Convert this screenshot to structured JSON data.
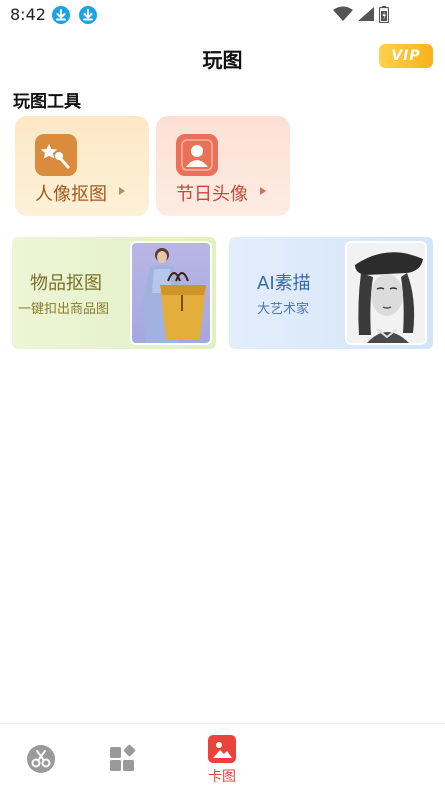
{
  "status_bar": {
    "time": "8:42",
    "icons": [
      "download-icon",
      "download-icon",
      "wifi-icon",
      "cell-signal-icon",
      "battery-icon"
    ]
  },
  "header": {
    "title": "玩图",
    "vip_label": "VIP",
    "vip_color": "#f6b21c"
  },
  "tools_section": {
    "title": "玩图工具",
    "tools": [
      {
        "label": "人像抠图",
        "icon": "magic-wand-icon",
        "color": "#d98b3e"
      },
      {
        "label": "节日头像",
        "icon": "avatar-icon",
        "color": "#ea7059"
      }
    ]
  },
  "features": [
    {
      "title": "物品抠图",
      "subtitle": "一键扣出商品图",
      "image": "woman-with-handbag"
    },
    {
      "title": "AI素描",
      "subtitle": "大艺术家",
      "image": "sketch-portrait"
    }
  ],
  "bottom_nav": {
    "items": [
      {
        "icon": "scissors-icon",
        "label": "",
        "active": false
      },
      {
        "icon": "grid-icon",
        "label": "",
        "active": false
      },
      {
        "icon": "image-icon",
        "label": "卡图",
        "active": true
      }
    ],
    "active_color": "#e8443b"
  }
}
